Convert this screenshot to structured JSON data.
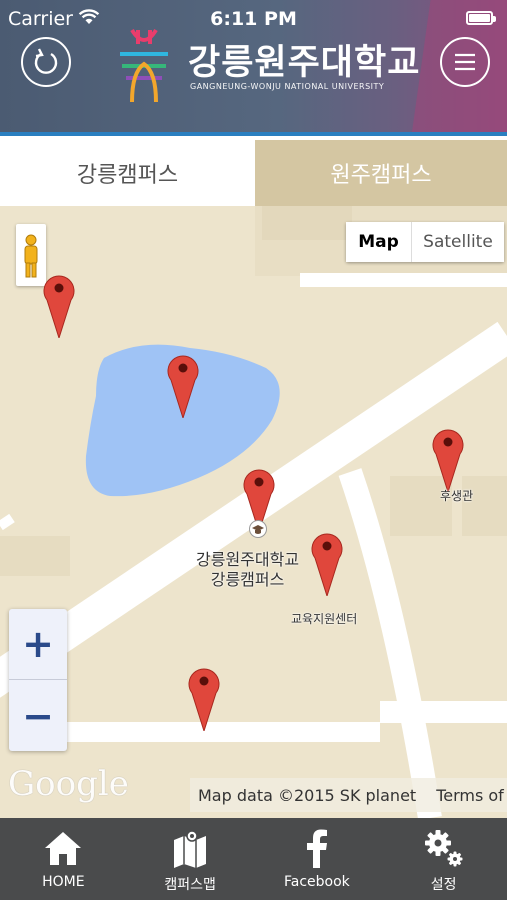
{
  "status_bar": {
    "carrier": "Carrier",
    "time": "6:11 PM"
  },
  "header": {
    "title": "강릉원주대학교",
    "subtitle": "GANGNEUNG-WONJU NATIONAL UNIVERSITY",
    "back_icon": "refresh-back-icon",
    "menu_icon": "hamburger-menu-icon"
  },
  "tabs": [
    {
      "label": "강릉캠퍼스",
      "active": true
    },
    {
      "label": "원주캠퍼스",
      "active": false
    }
  ],
  "map": {
    "type_buttons": {
      "map": "Map",
      "satellite": "Satellite"
    },
    "zoom_in": "+",
    "zoom_out": "−",
    "campus_label_line1": "강릉원주대학교",
    "campus_label_line2": "강릉캠퍼스",
    "marker_labels": {
      "welfare": "후생관",
      "education": "교육지원센터"
    },
    "google": "Google",
    "attribution": "Map data ©2015 SK planet",
    "terms": "Terms of Use",
    "colors": {
      "land": "#ede4cc",
      "water": "#9fc3f5",
      "road": "#ffffff",
      "marker": "#e0473c"
    }
  },
  "bottom_nav": [
    {
      "label": "HOME",
      "icon": "home-icon"
    },
    {
      "label": "캠퍼스맵",
      "icon": "map-icon"
    },
    {
      "label": "Facebook",
      "icon": "facebook-icon"
    },
    {
      "label": "설정",
      "icon": "settings-gear-icon"
    }
  ]
}
